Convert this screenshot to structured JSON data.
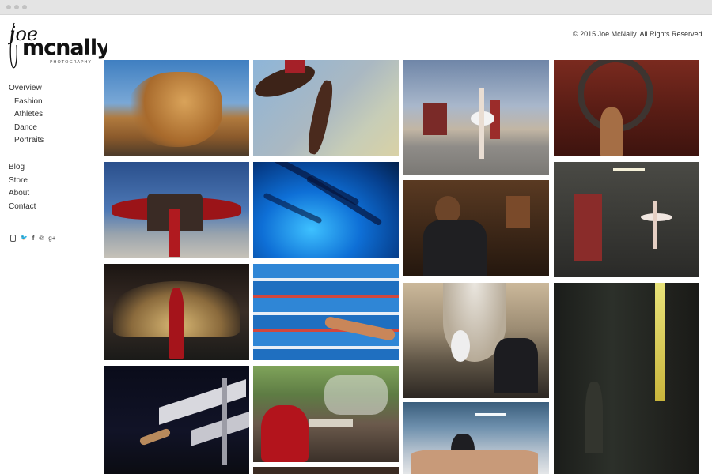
{
  "brand": {
    "script": "joe",
    "name": "mcnally",
    "tagline": "PHOTOGRAPHY"
  },
  "copyright": "© 2015 Joe McNally. All Rights Reserved.",
  "nav": {
    "primary": "Overview",
    "sub": [
      "Fashion",
      "Athletes",
      "Dance",
      "Portraits"
    ],
    "secondary": [
      "Blog",
      "Store",
      "About",
      "Contact"
    ]
  },
  "social": [
    "instagram-icon",
    "twitter-icon",
    "facebook-icon",
    "pinterest-icon",
    "google-plus-icon"
  ],
  "social_glyphs": {
    "twitter": "🐦",
    "facebook": "f",
    "pinterest": "℗",
    "gplus": "g+"
  }
}
